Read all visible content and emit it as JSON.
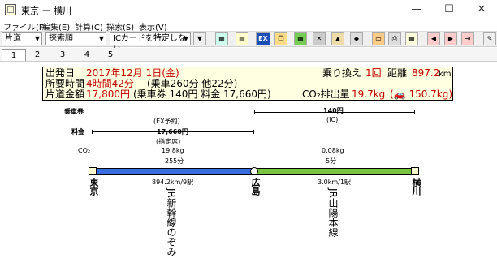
{
  "window": {
    "title": "東京 ー 横川",
    "min": "—",
    "max": "☐",
    "close": "✕"
  },
  "menu": [
    "ファイル(F)",
    "編集(E)",
    "計算(C)",
    "探索(S)",
    "表示(V)"
  ],
  "toolbar": {
    "direction": "片道",
    "sort": "探索順",
    "ic_card": "ICカードを特定しない"
  },
  "tabs": [
    "1",
    "2",
    "3",
    "4",
    "5"
  ],
  "summary": {
    "depart_label": "出発日",
    "depart_value": "2017年12月 1日(金)",
    "transfer_label": "乗り換え",
    "transfer_value": "1回",
    "distance_label": "距離",
    "distance_value": "897.2",
    "distance_unit": "km",
    "duration_label": "所要時間",
    "duration_value": "4時間42分",
    "duration_detail": "(乗車260分 他22分)",
    "fare_label": "片道金額",
    "fare_value": "17,800円",
    "fare_detail": "(乗車券 140円 料金 17,660円)",
    "co2_label": "CO₂排出量",
    "co2_value": "19.7kg",
    "co2_car": "(🚗 150.7kg)"
  },
  "route": {
    "ticket_label": "乗車券",
    "fee_label": "料金",
    "co2_label": "CO₂",
    "ticket_fare": "140円",
    "ticket_ic": "(IC)",
    "seg1_fee_note1": "(EX予約)",
    "seg1_fee": "17,660円",
    "seg1_fee_note2": "(指定席)",
    "seg1_co2": "19.8kg",
    "seg1_time": "255分",
    "seg1_dist": "894.2km/9駅",
    "seg1_line": "JR新幹線のぞみ",
    "seg2_co2": "0.08kg",
    "seg2_time": "5分",
    "seg2_dist": "3.0km/1駅",
    "seg2_line": "JR山陽本線",
    "station_a": "東京",
    "station_b": "広島",
    "station_c": "横川"
  },
  "colors": {
    "shinkansen": "#3a6de0",
    "sanyo": "#79c53f",
    "accent": "#c00000"
  }
}
